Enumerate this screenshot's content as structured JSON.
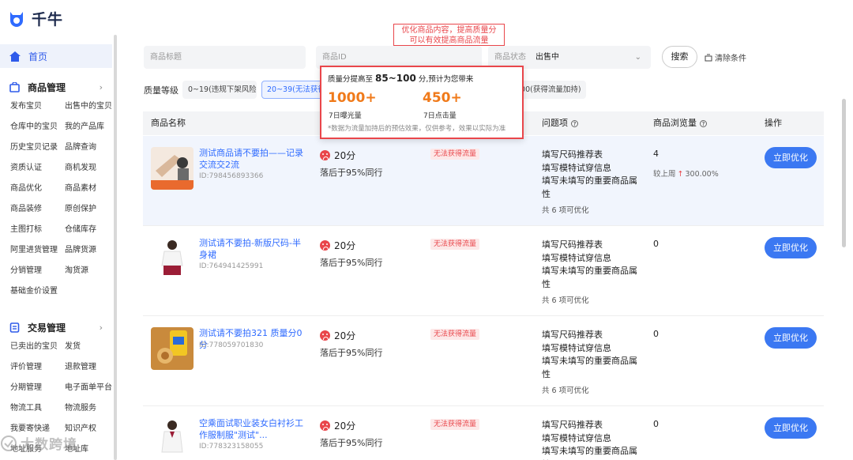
{
  "app": {
    "name": "千牛"
  },
  "sidebar": {
    "home": "首页",
    "sections": [
      {
        "title": "商品管理",
        "items": [
          "发布宝贝",
          "出售中的宝贝",
          "仓库中的宝贝",
          "我的产品库",
          "历史宝贝记录",
          "品牌查询",
          "资质认证",
          "商机发现",
          "商品优化",
          "商品素材",
          "商品装修",
          "原创保护",
          "主图打标",
          "仓储库存",
          "阿里进货管理",
          "品牌货源",
          "分销管理",
          "淘货源",
          "基础金价设置"
        ]
      },
      {
        "title": "交易管理",
        "items": [
          "已卖出的宝贝",
          "发货",
          "评价管理",
          "退款管理",
          "分期管理",
          "电子面单平台",
          "物流工具",
          "物流服务",
          "我要寄快递",
          "知识产权",
          "地址服务",
          "地址库"
        ]
      }
    ]
  },
  "filters": {
    "title_placeholder": "商品标题",
    "id_placeholder": "商品ID",
    "status_label": "商品状态",
    "status_value": "出售中",
    "search": "搜索",
    "clear": "清除条件"
  },
  "quality": {
    "label": "质量等级",
    "chips": [
      "0~19(违规下架风险)",
      "20~39(无法获得流量)",
      "100(获得流量加持)"
    ]
  },
  "table": {
    "headers": {
      "name": "商品名称",
      "issues": "问题项",
      "views": "商品浏览量",
      "action": "操作"
    },
    "rows": [
      {
        "name": "测试商品请不要拍——记录交流交2流",
        "id": "ID:798456893366",
        "score": "20分",
        "behind": "落后于95%同行",
        "tag": "无法获得流量",
        "issues": [
          "填写尺码推荐表",
          "填写模特试穿信息",
          "填写未填写的重要商品属性"
        ],
        "issue_count": "共 6 项可优化",
        "views": "4",
        "trend_label": "较上周",
        "trend_value": "300.00%",
        "action": "立即优化"
      },
      {
        "name": "测试请不要拍-新版尺码-半身裙",
        "id": "ID:764941425991",
        "score": "20分",
        "behind": "落后于95%同行",
        "tag": "无法获得流量",
        "issues": [
          "填写尺码推荐表",
          "填写模特试穿信息",
          "填写未填写的重要商品属性"
        ],
        "issue_count": "共 6 项可优化",
        "views": "0",
        "action": "立即优化"
      },
      {
        "name": "测试请不要拍321 质量分0分",
        "id": "ID:778059701830",
        "score": "20分",
        "behind": "落后于95%同行",
        "tag": "无法获得流量",
        "issues": [
          "填写尺码推荐表",
          "填写模特试穿信息",
          "填写未填写的重要商品属性"
        ],
        "issue_count": "共 6 项可优化",
        "views": "0",
        "action": "立即优化"
      },
      {
        "name": "空乘面试职业装女白衬衫工作服制服\"测试\"...",
        "id": "ID:778323158055",
        "score": "20分",
        "behind": "落后于95%同行",
        "tag": "无法获得流量",
        "issues": [
          "填写尺码推荐表",
          "填写模特试穿信息",
          "填写未填写的重要商品属性"
        ],
        "views": "0",
        "action": "立即优化"
      }
    ]
  },
  "callout": {
    "line1": "优化商品内容，提高质量分",
    "line2": "可以有效提高商品流量"
  },
  "popup": {
    "prefix": "质量分提高至",
    "range": "85~100",
    "suffix": "分,预计为您带来",
    "exposure_value": "1000+",
    "exposure_label": "7日曝光量",
    "click_value": "450+",
    "click_label": "7日点击量",
    "note": "*数据为流量加持后的预估效果，仅供参考，效果以实际为准"
  },
  "watermark": "大数跨境",
  "colors": {
    "accent": "#3b78f2",
    "danger": "#e9464b",
    "orange": "#f07a1a"
  }
}
